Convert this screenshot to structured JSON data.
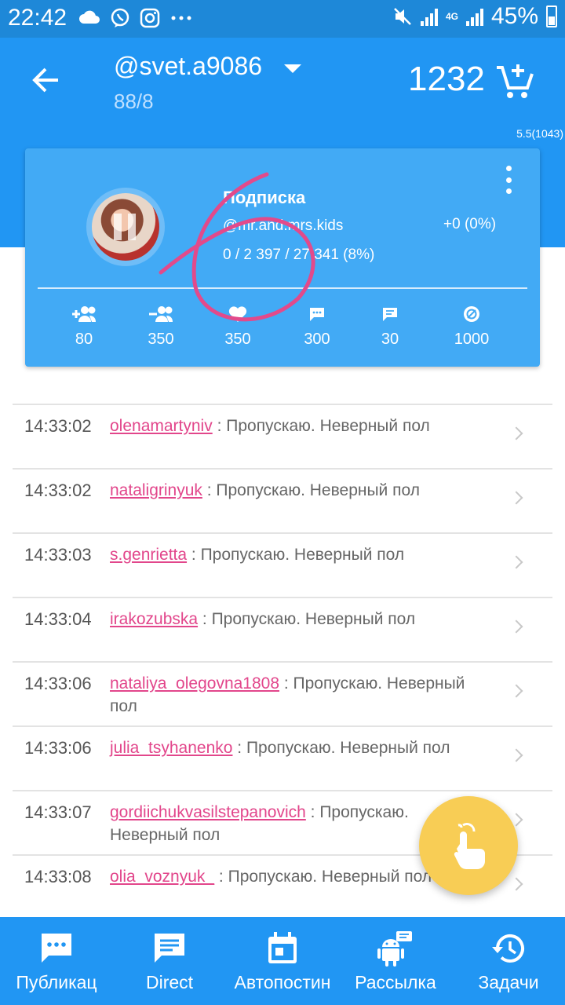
{
  "status_bar": {
    "time": "22:42",
    "battery": "45%",
    "network": "4G"
  },
  "app_bar": {
    "account": "@svet.a9086",
    "subtitle": "88/8",
    "balance": "1232"
  },
  "version": "5.5(1043)",
  "task_card": {
    "title": "Подписка",
    "target": "@mr.and.mrs.kids",
    "progress": "0 / 2 397 / 27 341 (8%)",
    "delta": "+0 (0%)",
    "stats": [
      {
        "icon": "add-people-icon",
        "value": "80"
      },
      {
        "icon": "remove-people-icon",
        "value": "350"
      },
      {
        "icon": "heart-icon",
        "value": "350"
      },
      {
        "icon": "comment-icon",
        "value": "300"
      },
      {
        "icon": "message-icon",
        "value": "30"
      },
      {
        "icon": "no-entry-icon",
        "value": "1000"
      }
    ]
  },
  "log": [
    {
      "time": "14:33:02",
      "user": "olenamartyniv",
      "text": " : Пропускаю. Неверный пол"
    },
    {
      "time": "14:33:02",
      "user": "nataligrinyuk",
      "text": " : Пропускаю. Неверный пол"
    },
    {
      "time": "14:33:03",
      "user": "s.genrietta",
      "text": " : Пропускаю. Неверный пол"
    },
    {
      "time": "14:33:04",
      "user": "irakozubska",
      "text": " : Пропускаю. Неверный пол"
    },
    {
      "time": "14:33:06",
      "user": "nataliya_olegovna1808",
      "text": " : Пропускаю. Неверный пол"
    },
    {
      "time": "14:33:06",
      "user": "julia_tsyhanenko",
      "text": " : Пропускаю. Неверный пол"
    },
    {
      "time": "14:33:07",
      "user": "gordiichukvasilstepanovich",
      "text": " : Пропускаю. Неверный пол"
    },
    {
      "time": "14:33:08",
      "user": "olia_voznyuk_",
      "text": " : Пропускаю. Неверный пол"
    }
  ],
  "bottom_nav": [
    {
      "icon": "chat-dots-icon",
      "label": "Публикац"
    },
    {
      "icon": "message-icon",
      "label": "Direct"
    },
    {
      "icon": "calendar-icon",
      "label": "Автопостин"
    },
    {
      "icon": "android-icon",
      "label": "Рассылка"
    },
    {
      "icon": "history-icon",
      "label": "Задачи"
    }
  ],
  "colors": {
    "primary": "#2196f3",
    "card": "#42aaf5",
    "username": "#e2468b",
    "fab": "#f8cd55"
  }
}
